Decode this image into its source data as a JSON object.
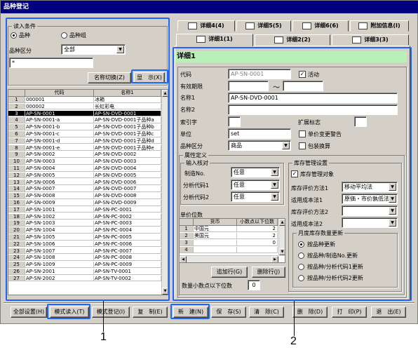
{
  "window": {
    "title": "品种登记"
  },
  "search": {
    "group_title": "读入条件",
    "radio_item": "品种",
    "radio_group": "品种组",
    "class_label": "品种区分",
    "class_value": "全部",
    "input_value": "*",
    "name_switch": "名称切换(Z)",
    "show": "显　示(X)"
  },
  "grid": {
    "headers": [
      "代码",
      "名称1"
    ],
    "rows": [
      [
        "1",
        "000001",
        "冰箱"
      ],
      [
        "2",
        "000002",
        "长虹彩电"
      ],
      [
        "3",
        "AP-SN-0001",
        "AP-SN-DVD-0001"
      ],
      [
        "4",
        "AP-SN-0001-a",
        "AP-SN-DVD-0001子品种a"
      ],
      [
        "5",
        "AP-SN-0001-b",
        "AP-SN-DVD-0001子品种b"
      ],
      [
        "6",
        "AP-SN-0001-c",
        "AP-SN-DVD-0001子品种c"
      ],
      [
        "7",
        "AP-SN-0001-d",
        "AP-SN-DVD-0001子品种d"
      ],
      [
        "8",
        "AP-SN-0001-e",
        "AP-SN-DVD-0001子品种e"
      ],
      [
        "9",
        "AP-SN-0002",
        "AP-SN-DVD-0002"
      ],
      [
        "10",
        "AP-SN-0003",
        "AP-SN-DVD-0003"
      ],
      [
        "11",
        "AP-SN-0004",
        "AP-SN-DVD-0004"
      ],
      [
        "12",
        "AP-SN-0005",
        "AP-SN-DVD-0005"
      ],
      [
        "13",
        "AP-SN-0006",
        "AP-SN-DVD-0006"
      ],
      [
        "14",
        "AP-SN-0007",
        "AP-SN-DVD-0007"
      ],
      [
        "15",
        "AP-SN-0008",
        "AP-SN-DVD-0008"
      ],
      [
        "16",
        "AP-SN-0009",
        "AP-SN-DVD-0009"
      ],
      [
        "17",
        "AP-SN-1001",
        "AP-SN-PC-0001"
      ],
      [
        "18",
        "AP-SN-1002",
        "AP-SN-PC-0002"
      ],
      [
        "19",
        "AP-SN-1003",
        "AP-SN-PC-0003"
      ],
      [
        "20",
        "AP-SN-1004",
        "AP-SN-PC-0004"
      ],
      [
        "21",
        "AP-SN-1005",
        "AP-SN-PC-0005"
      ],
      [
        "22",
        "AP-SN-1006",
        "AP-SN-PC-0006"
      ],
      [
        "23",
        "AP-SN-1007",
        "AP-SN-PC-0007"
      ],
      [
        "24",
        "AP-SN-1008",
        "AP-SN-PC-0008"
      ],
      [
        "25",
        "AP-SN-1009",
        "AP-SN-PC-0009"
      ],
      [
        "26",
        "AP-SN-2001",
        "AP-SN-TV-0001"
      ],
      [
        "27",
        "AP-SN-2002",
        "AP-SN-TV-0002"
      ]
    ]
  },
  "tabs": {
    "detail4": "详细4(4)",
    "detail5": "详细5(5)",
    "detail6": "详细6(6)",
    "extra": "附加信息(I)",
    "detail1": "详细1(1)",
    "detail2": "详细2(2)",
    "detail3": "详细3(3)"
  },
  "detail": {
    "header": "详细1",
    "code_label": "代码",
    "code_value": "AP-SN-0001",
    "active_label": "活动",
    "valid_label": "有效期限",
    "tilde": "～",
    "name1_label": "名称1",
    "name1_value": "AP-SN-DVD-0001",
    "name2_label": "名称2",
    "index_label": "索引字",
    "ext_label": "扩展标志",
    "unit_label": "单位",
    "unit_value": "set",
    "unit_change_label": "单价变更警告",
    "class_label": "品种区分",
    "class_value": "商品",
    "pack_label": "包装换算",
    "attr_group": "属性定义",
    "input_group": "输入核对",
    "mfg_label": "制造No.",
    "mfg_value": "任意",
    "ana1_label": "分析代码1",
    "ana1_value": "任意",
    "ana2_label": "分析代码2",
    "ana2_value": "任意",
    "price_digits_label": "单价位数",
    "price_headers": [
      "货币",
      "小数点以下位数"
    ],
    "price_rows": [
      [
        "1",
        "中国元",
        "2"
      ],
      [
        "2",
        "美国元",
        "2"
      ],
      [
        "3",
        "",
        "0"
      ],
      [
        "4",
        "",
        ""
      ]
    ],
    "add_row": "追加行(G)",
    "del_row": "删除行(J)",
    "qty_digits_label": "数量小数点以下位数",
    "qty_digits_value": "0",
    "stock_group": "库存管理设置",
    "stock_target_label": "库存管理对象",
    "eval1_label": "库存评价方法1",
    "eval1_value": "移动平均法",
    "cost1_label": "适用成本法1",
    "cost1_value": "原価・市价孰低法",
    "eval2_label": "库存评价方法2",
    "cost2_label": "适用成本法2",
    "monthly_group": "月度库存数量更新",
    "opt1": "按品种更新",
    "opt2": "按品种/制造No.更新",
    "opt3": "按品种/分析代码1更新",
    "opt4": "按品种/分析代码2更新"
  },
  "footer": {
    "all_settings": "全部设置(H)",
    "pattern_read": "模式读入(T)",
    "pattern_reg": "模式登记(I)",
    "copy": "复　制(E)",
    "new": "新　建(N)",
    "save": "保　存(S)",
    "clear": "清　除(C)",
    "delete": "删　除(D)",
    "print": "打　印(P)",
    "exit": "退　出(E)"
  },
  "callouts": {
    "one": "1",
    "two": "2"
  },
  "colors": {
    "title_bg": "#000080",
    "callout_border": "#1e64ff",
    "detail_header": "#b8f0b8"
  }
}
